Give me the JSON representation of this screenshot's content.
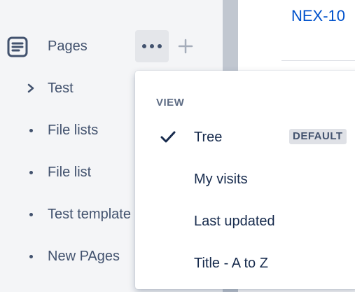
{
  "main": {
    "issue_key": "NEX-10"
  },
  "sidebar": {
    "section_title": "Pages",
    "tree": [
      {
        "label": "Test",
        "marker": "chevron-right-icon"
      },
      {
        "label": "File lists",
        "marker": "bullet"
      },
      {
        "label": "File list",
        "marker": "bullet"
      },
      {
        "label": "Test template",
        "marker": "bullet"
      },
      {
        "label": "New PAges",
        "marker": "bullet"
      }
    ]
  },
  "dropdown": {
    "heading": "VIEW",
    "options": [
      {
        "label": "Tree",
        "selected": true,
        "badge": "DEFAULT"
      },
      {
        "label": "My visits",
        "selected": false
      },
      {
        "label": "Last updated",
        "selected": false
      },
      {
        "label": "Title - A to Z",
        "selected": false
      }
    ]
  },
  "colors": {
    "link": "#0052cc",
    "sidebar_bg": "#f4f5f7",
    "text": "#42526e",
    "badge_bg": "#dfe1e6"
  }
}
